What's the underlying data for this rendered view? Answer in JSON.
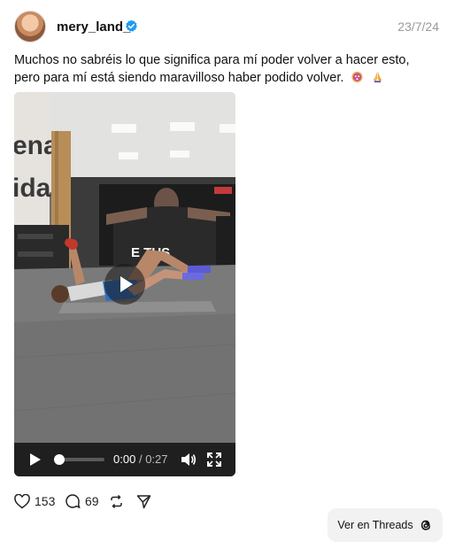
{
  "post": {
    "username": "mery_land_",
    "date": "23/7/24",
    "caption_line1": "Muchos no sabréis lo que significa para mí poder volver a hacer esto,",
    "caption_line2": "pero para mí está siendo maravilloso haber podido volver.",
    "emojis": [
      "face-emoji",
      "praying-hands-emoji"
    ]
  },
  "video": {
    "wall_text_line1": "ena",
    "wall_text_line2": "ida",
    "poster_text": "E TUS",
    "current_time": "0:00",
    "time_separator": "/",
    "duration": "0:27",
    "progress": 0
  },
  "actions": {
    "likes": "153",
    "replies": "69"
  },
  "threads_button": {
    "label": "Ver en Threads"
  },
  "colors": {
    "verified": "#1d9bf0",
    "date": "#9a9a9a",
    "controls_bg": "#1f1f1f",
    "button_bg": "#f2f2f2"
  }
}
